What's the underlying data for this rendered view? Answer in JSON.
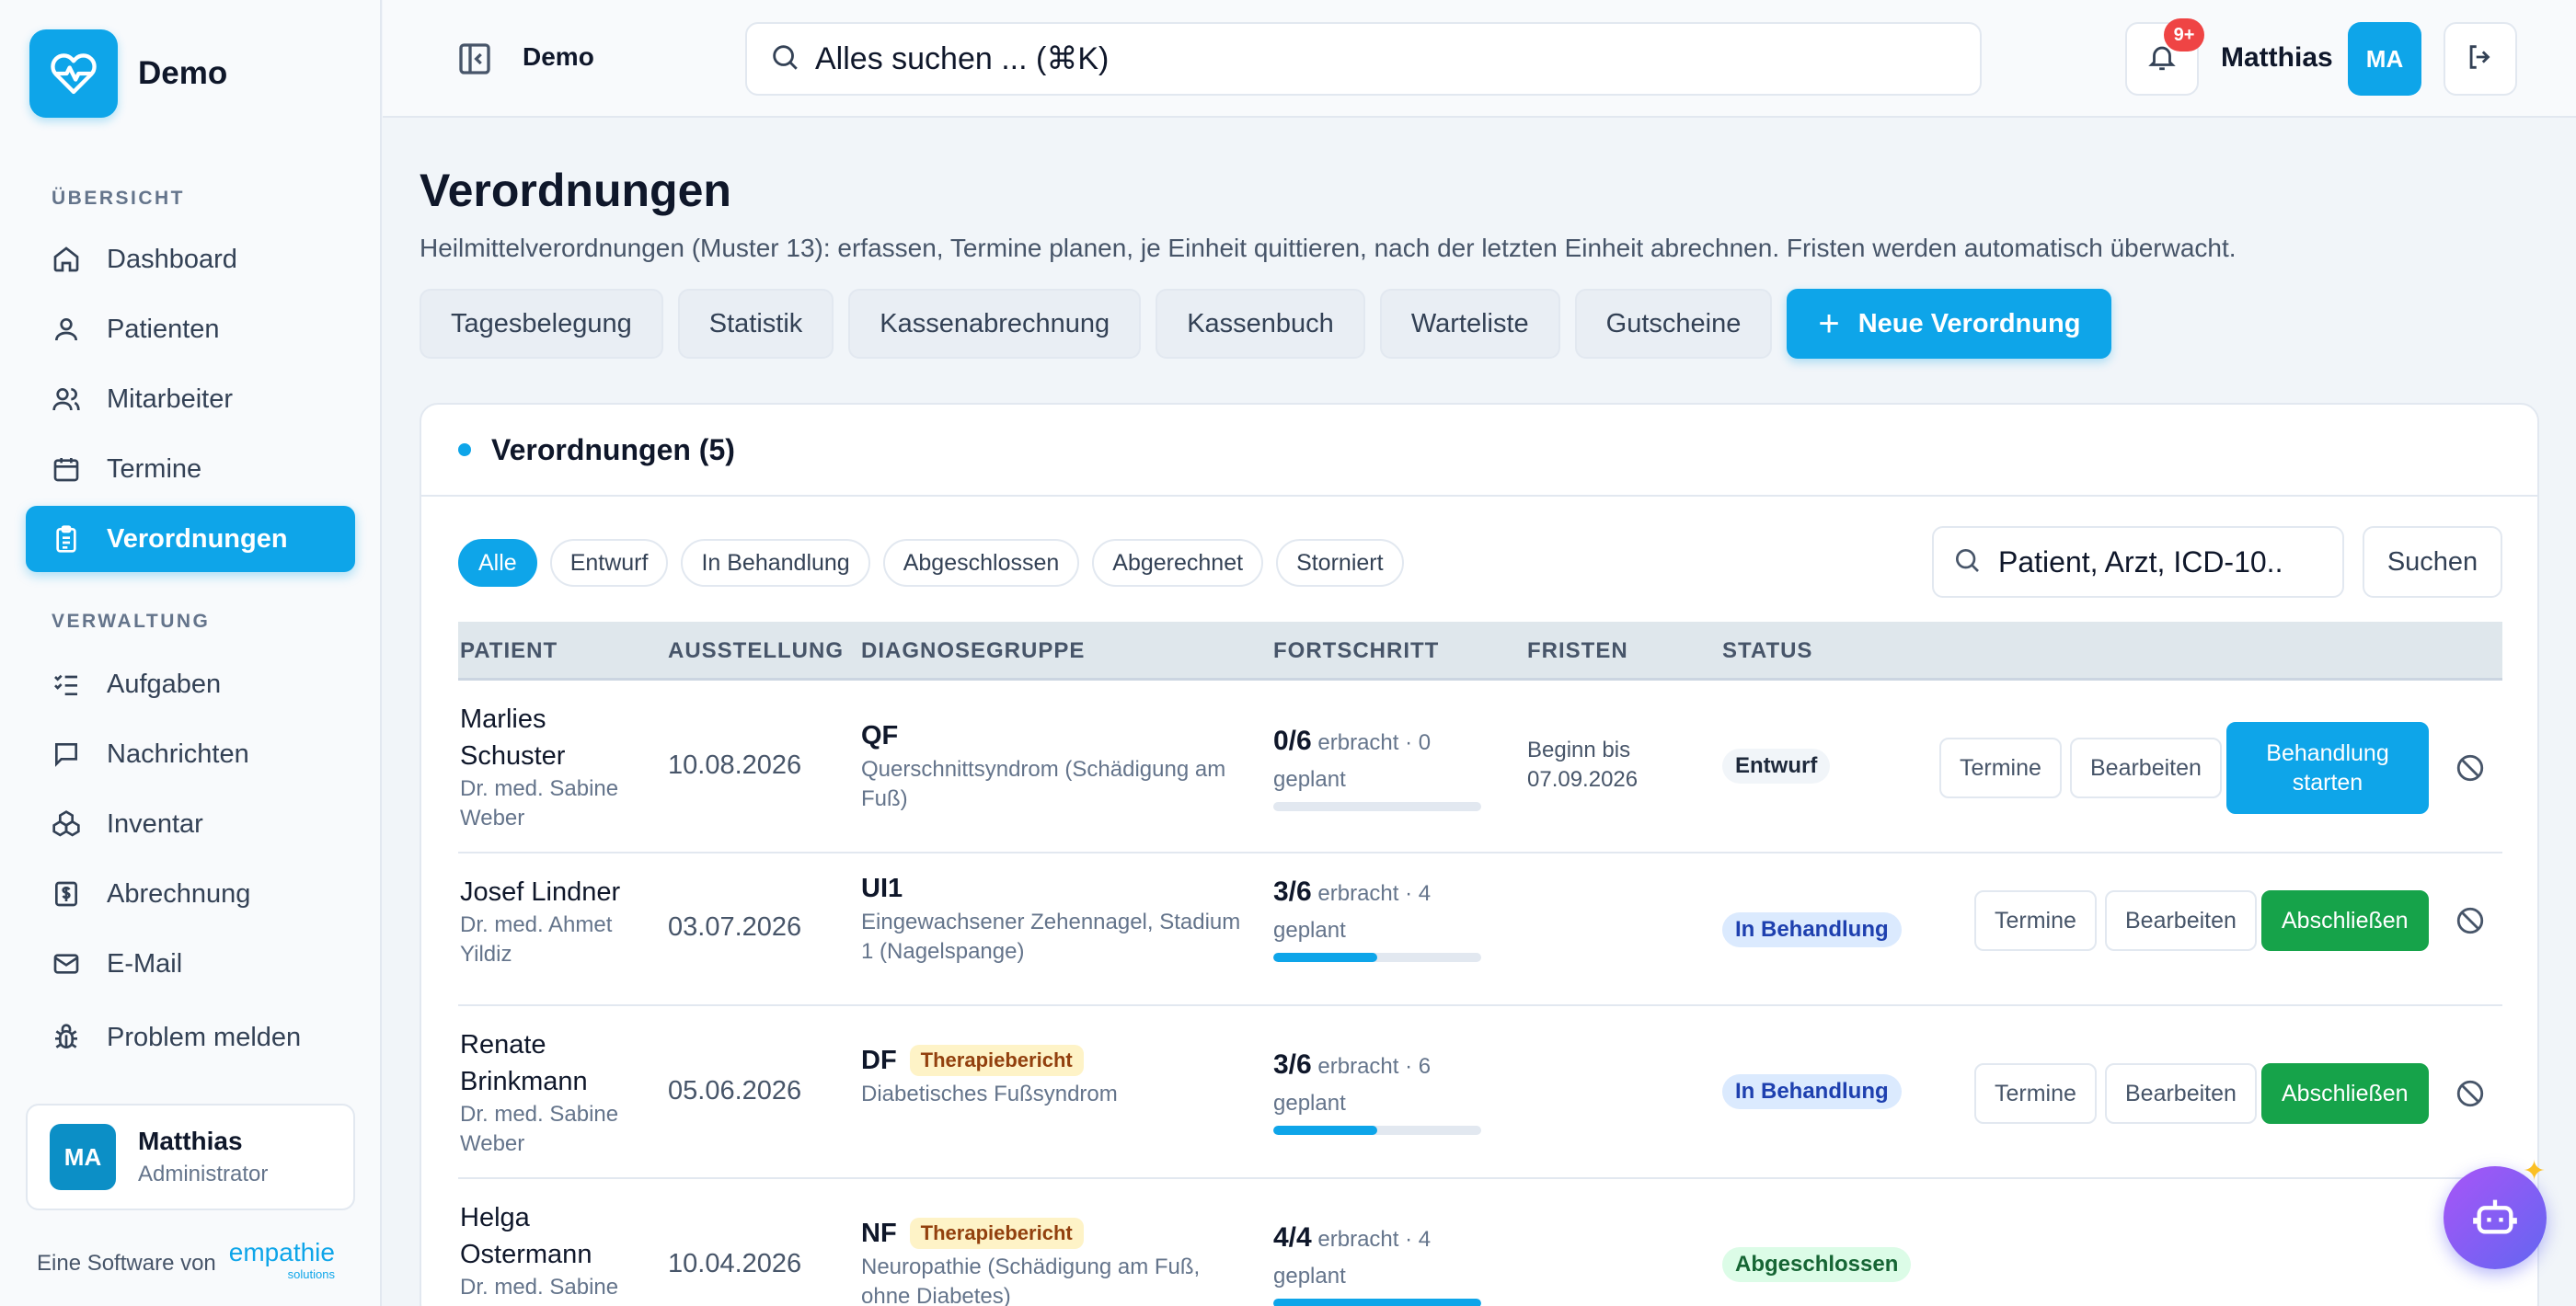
{
  "brand": {
    "name": "Demo"
  },
  "sidebar": {
    "section_overview": "ÜBERSICHT",
    "section_admin": "VERWALTUNG",
    "items": [
      {
        "label": "Dashboard",
        "icon": "home-icon"
      },
      {
        "label": "Patienten",
        "icon": "user-icon"
      },
      {
        "label": "Mitarbeiter",
        "icon": "users-icon"
      },
      {
        "label": "Termine",
        "icon": "calendar-icon"
      },
      {
        "label": "Verordnungen",
        "icon": "clipboard-icon",
        "active": true
      },
      {
        "label": "Aufgaben",
        "icon": "checklist-icon"
      },
      {
        "label": "Nachrichten",
        "icon": "message-icon"
      },
      {
        "label": "Inventar",
        "icon": "boxes-icon"
      },
      {
        "label": "Abrechnung",
        "icon": "receipt-icon"
      },
      {
        "label": "E-Mail",
        "icon": "mail-icon"
      },
      {
        "label": "Problem melden",
        "icon": "bug-icon"
      }
    ],
    "user": {
      "initials": "MA",
      "name": "Matthias",
      "role": "Administrator"
    },
    "footer": {
      "text": "Eine Software von",
      "logo": "empathie",
      "logo_sub": "solutions"
    }
  },
  "topbar": {
    "breadcrumb": "Demo",
    "search_text": "Alles suchen ...   (⌘K)",
    "notification_badge": "9+",
    "user_name": "Matthias",
    "user_initials": "MA"
  },
  "page": {
    "title": "Verordnungen",
    "subtitle": "Heilmittelverordnungen (Muster 13): erfassen, Termine planen, je Einheit quittieren, nach der letzten Einheit abrechnen. Fristen werden automatisch überwacht.",
    "quick_buttons": [
      "Tagesbelegung",
      "Statistik",
      "Kassenabrechnung",
      "Kassenbuch",
      "Warteliste",
      "Gutscheine"
    ],
    "new_button": "Neue Verordnung"
  },
  "card": {
    "title": "Verordnungen (5)",
    "filters": [
      "Alle",
      "Entwurf",
      "In Behandlung",
      "Abgeschlossen",
      "Abgerechnet",
      "Storniert"
    ],
    "active_filter": "Alle",
    "search_placeholder": "Patient, Arzt, ICD-10..",
    "search_button": "Suchen",
    "columns": [
      "PATIENT",
      "AUSSTELLUNG",
      "DIAGNOSEGRUPPE",
      "FORTSCHRITT",
      "FRISTEN",
      "STATUS"
    ],
    "rows": [
      {
        "patient": "Marlies Schuster",
        "doctor": "Dr. med. Sabine Weber",
        "date": "10.08.2026",
        "code": "QF",
        "tag": "",
        "diagnosis": "Querschnittsyndrom (Schädigung am Fuß)",
        "progress_main": "0/6",
        "progress_text": "erbracht · 0 geplant",
        "progress_fraction": 0.0,
        "deadline": "Beginn bis 07.09.2026",
        "status": "Entwurf",
        "actions": [
          "Termine",
          "Bearbeiten",
          "Behandlung starten"
        ]
      },
      {
        "patient": "Josef Lindner",
        "doctor": "Dr. med. Ahmet Yildiz",
        "date": "03.07.2026",
        "code": "UI1",
        "tag": "",
        "diagnosis": "Eingewachsener Zehennagel, Stadium 1 (Nagelspange)",
        "progress_main": "3/6",
        "progress_text": "erbracht · 4 geplant",
        "progress_fraction": 0.5,
        "deadline": "",
        "status": "In Behandlung",
        "actions": [
          "Termine",
          "Bearbeiten",
          "Abschließen"
        ]
      },
      {
        "patient": "Renate Brinkmann",
        "doctor": "Dr. med. Sabine Weber",
        "date": "05.06.2026",
        "code": "DF",
        "tag": "Therapiebericht",
        "diagnosis": "Diabetisches Fußsyndrom",
        "progress_main": "3/6",
        "progress_text": "erbracht · 6 geplant",
        "progress_fraction": 0.5,
        "deadline": "",
        "status": "In Behandlung",
        "actions": [
          "Termine",
          "Bearbeiten",
          "Abschließen"
        ]
      },
      {
        "patient": "Helga Ostermann",
        "doctor": "Dr. med. Sabine Weber",
        "date": "10.04.2026",
        "code": "NF",
        "tag": "Therapiebericht",
        "diagnosis": "Neuropathie (Schädigung am Fuß, ohne Diabetes)",
        "progress_main": "4/4",
        "progress_text": "erbracht · 4 geplant",
        "progress_fraction": 1.0,
        "deadline": "",
        "status": "Abgeschlossen",
        "actions": []
      }
    ]
  },
  "colors": {
    "accent": "#0ea5e9",
    "success": "#16a34a",
    "danger": "#ef4444"
  }
}
